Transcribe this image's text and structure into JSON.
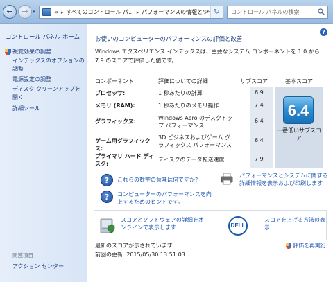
{
  "address_bar": {
    "breadcrumbs": [
      "すべてのコントロール パ...",
      "パフォーマンスの情報とツール"
    ],
    "overflow_chevron": "«"
  },
  "search": {
    "placeholder": "コントロール パネルの検索"
  },
  "sidebar": {
    "home": "コントロール パネル ホーム",
    "items": [
      {
        "label": "視覚効果の調整",
        "shield": true
      },
      {
        "label": "インデックスのオプションの調整",
        "shield": false
      },
      {
        "label": "電源設定の調整",
        "shield": false
      },
      {
        "label": "ディスク クリーンアップを開く",
        "shield": false
      },
      {
        "label": "詳細ツール",
        "shield": false
      }
    ],
    "see_also": "関連項目",
    "action_center": "アクション センター"
  },
  "main": {
    "title": "お使いのコンピューターのパフォーマンスの評価と改善",
    "intro": "Windows エクスペリエンス インデックスは、主要なシステム コンポーネントを 1.0 から 7.9 のスコアで評価した値です。",
    "table": {
      "headers": {
        "component": "コンポーネント",
        "detail": "評価についての詳細",
        "subscore": "サブスコア",
        "basescore": "基本スコア"
      },
      "rows": [
        {
          "component": "プロセッサ:",
          "detail": "1 秒あたりの計算",
          "subscore": "6.9"
        },
        {
          "component": "メモリ (RAM):",
          "detail": "1 秒あたりのメモリ操作",
          "subscore": "7.4"
        },
        {
          "component": "グラフィックス:",
          "detail": "Windows Aero のデスクトップ パフォーマンス",
          "subscore": "6.4"
        },
        {
          "component": "ゲーム用グラフィックス:",
          "detail": "3D ビジネスおよびゲーム グラフィックス パフォーマンス",
          "subscore": "6.4"
        },
        {
          "component": "プライマリ ハード ディスク:",
          "detail": "ディスクのデータ転送速度",
          "subscore": "7.9"
        }
      ],
      "base_score": "6.4",
      "base_label": "一番低いサブスコア"
    },
    "links": {
      "meaning": "これらの数字の意味は何ですか?",
      "tips": "コンピューターのパフォーマンスを向上するためのヒントです。",
      "print": "パフォーマンスとシステムに関する詳細情報を表示および印刷します"
    },
    "vendor": {
      "software_link": "スコアとソフトウェアの詳細をオンラインで表示します",
      "logo_text": "DELL",
      "improve_link": "スコアを上げる方法の表示"
    },
    "status": "最新のスコアが示されています",
    "last_update": "前回の更新: 2015/05/30 13:51:03",
    "rerun": "評価を再実行"
  }
}
